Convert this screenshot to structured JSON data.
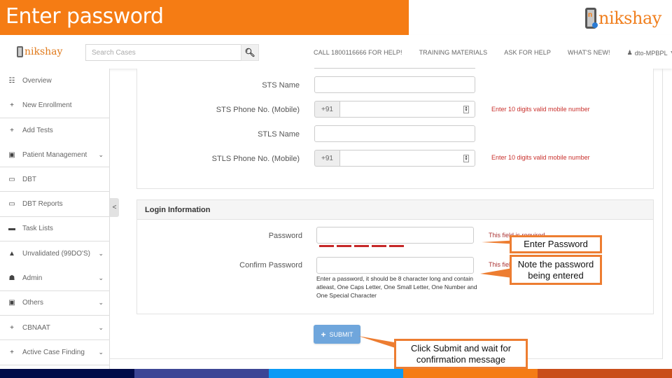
{
  "slide": {
    "title": "Enter password",
    "brand_word": "nikshay",
    "brand_letter": "n"
  },
  "header": {
    "logo_word": "nikshay",
    "search_placeholder": "Search Cases",
    "search_icon": "search-icon",
    "nav": [
      {
        "label": "CALL 1800116666 FOR HELP!"
      },
      {
        "label": "TRAINING MATERIALS"
      },
      {
        "label": "ASK FOR HELP"
      },
      {
        "label": "WHAT'S NEW!"
      }
    ],
    "user": {
      "label": "dto-MPBPL",
      "icon": "user-icon"
    }
  },
  "sidebar": {
    "items": [
      {
        "label": "Overview",
        "icon": "dashboard-icon",
        "glyph": "☷",
        "has_chevron": false
      },
      {
        "label": "New Enrollment",
        "icon": "plus-icon",
        "glyph": "+",
        "has_chevron": false
      },
      {
        "label": "Add Tests",
        "icon": "plus-icon",
        "glyph": "+",
        "has_chevron": false
      },
      {
        "label": "Patient Management",
        "icon": "briefcase-icon",
        "glyph": "▣",
        "has_chevron": true
      },
      {
        "label": "DBT",
        "icon": "money-icon",
        "glyph": "▭",
        "has_chevron": false
      },
      {
        "label": "DBT Reports",
        "icon": "money-icon",
        "glyph": "▭",
        "has_chevron": false
      },
      {
        "label": "Task Lists",
        "icon": "list-icon",
        "glyph": "▬",
        "has_chevron": false
      },
      {
        "label": "Unvalidated (99DO'S)",
        "icon": "warning-icon",
        "glyph": "▲",
        "has_chevron": true
      },
      {
        "label": "Admin",
        "icon": "user-icon",
        "glyph": "☗",
        "has_chevron": true
      },
      {
        "label": "Others",
        "icon": "briefcase-icon",
        "glyph": "▣",
        "has_chevron": true
      },
      {
        "label": "CBNAAT",
        "icon": "plus-icon",
        "glyph": "+",
        "has_chevron": true
      },
      {
        "label": "Active Case Finding",
        "icon": "plus-icon",
        "glyph": "+",
        "has_chevron": true
      }
    ],
    "collapse_glyph": "<"
  },
  "form_top": {
    "fields": [
      {
        "label": "STS Name",
        "type": "text",
        "value": ""
      },
      {
        "label": "STS Phone No. (Mobile)",
        "type": "phone",
        "prefix": "+91",
        "value": "",
        "error": "Enter 10 digits valid mobile number"
      },
      {
        "label": "STLS Name",
        "type": "text",
        "value": ""
      },
      {
        "label": "STLS Phone No. (Mobile)",
        "type": "phone",
        "prefix": "+91",
        "value": "",
        "error": "Enter 10 digits valid mobile number"
      }
    ]
  },
  "login": {
    "heading": "Login Information",
    "password_label": "Password",
    "password_value": "",
    "password_error": "This field is required",
    "confirm_label": "Confirm Password",
    "confirm_value": "",
    "confirm_error": "This field is required",
    "hint": "Enter a password, it should be 8 character long and contain atleast, One Caps Letter, One Small Letter, One Number and One Special Character",
    "submit_label": "SUBMIT"
  },
  "callouts": {
    "enter_password": "Enter Password",
    "note_password": "Note the password being entered",
    "submit": "Click Submit and wait for confirmation message"
  },
  "colors": {
    "banner": "#f57c14",
    "callout_border": "#ed7d31",
    "error": "#c9302c",
    "submit": "#6fa6dc",
    "bar": [
      "#000b48",
      "#3c4595",
      "#0a9af5",
      "#f57c14",
      "#c94d1a"
    ]
  }
}
